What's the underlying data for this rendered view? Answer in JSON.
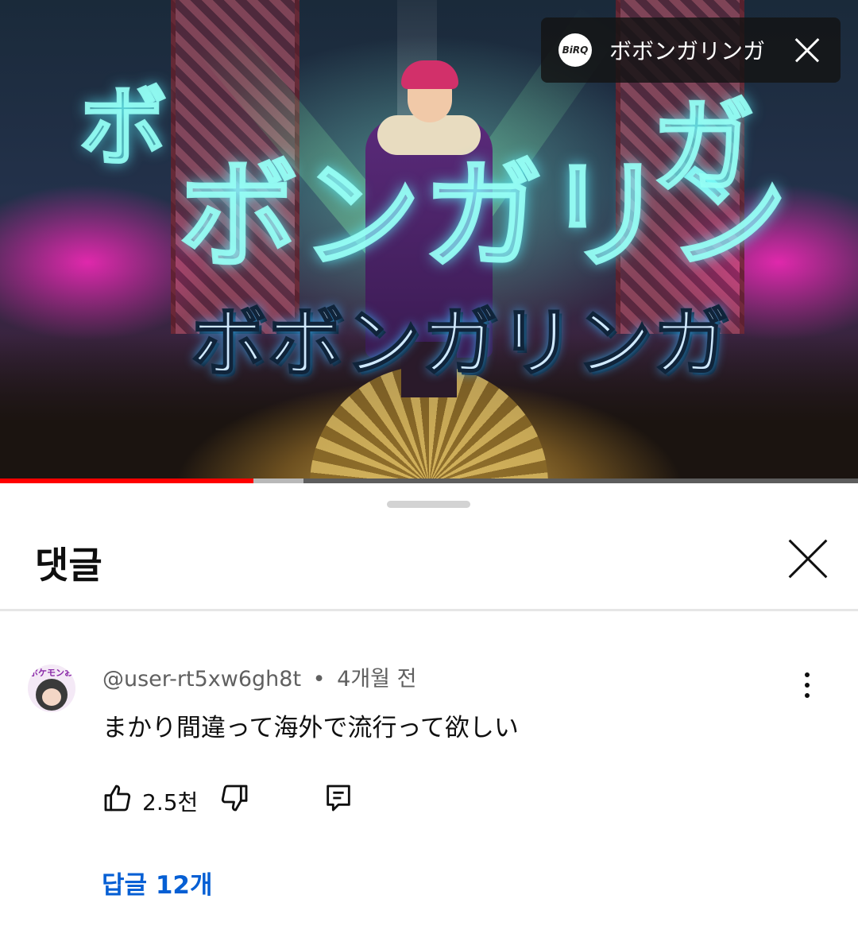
{
  "video": {
    "overlay_title": "ボボンガリンガ",
    "channel_logo_text": "BiRQ",
    "title_art_main": "ボボンガリンガ",
    "title_art_back_left": "ボ",
    "title_art_back_center": "ボンガリン",
    "title_art_back_right": "ガ",
    "progress": {
      "played_fraction": 0.295,
      "buffered_fraction": 0.354
    },
    "colors": {
      "progress_played": "#ff0000",
      "progress_buffered": "#b8b8b8",
      "progress_track": "#5d5d5d"
    }
  },
  "comments_panel": {
    "title": "댓글",
    "comment": {
      "author": "@user-rt5xw6gh8t",
      "separator": "•",
      "time": "4개월 전",
      "text": "まかり間違って海外で流行って欲しい",
      "like_count": "2.5천",
      "replies_label": "답글 12개",
      "avatar_tag": "ポケモンおつじ"
    },
    "icons": [
      "close-icon",
      "more-vert-icon",
      "thumb-up-icon",
      "thumb-down-icon",
      "reply-icon"
    ],
    "colors": {
      "link": "#065fd4",
      "text": "#0f0f0f",
      "meta": "#606060"
    }
  }
}
